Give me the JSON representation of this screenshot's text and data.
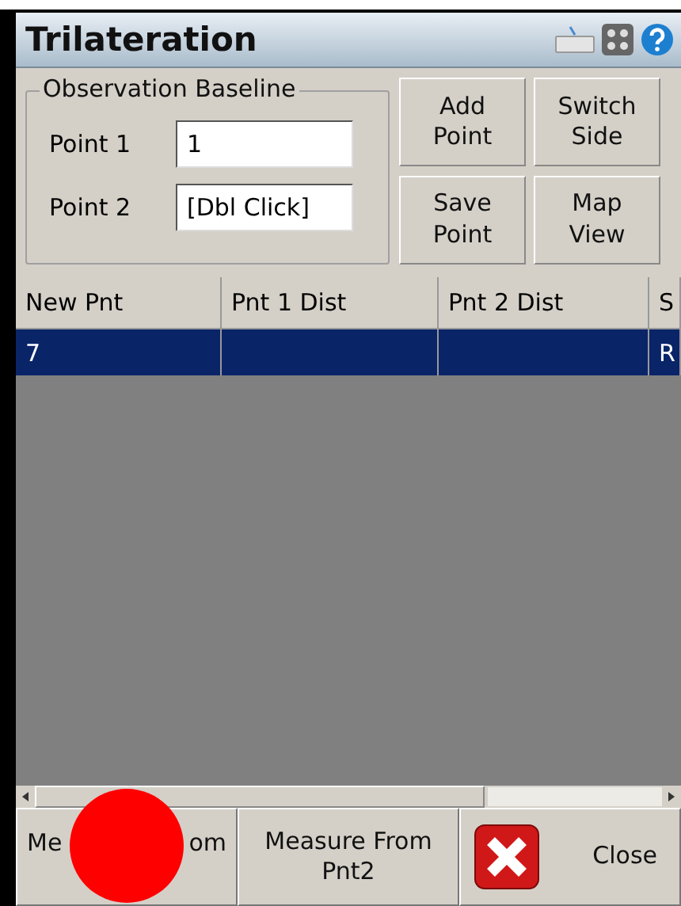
{
  "window": {
    "title": "Trilateration"
  },
  "baseline": {
    "title": "Observation Baseline",
    "fields": [
      {
        "label": "Point 1",
        "value": "1"
      },
      {
        "label": "Point 2",
        "value": "[Dbl Click]"
      }
    ]
  },
  "buttons": [
    {
      "label": "Add Point"
    },
    {
      "label": "Switch Side"
    },
    {
      "label": "Save Point"
    },
    {
      "label": "Map View"
    }
  ],
  "table": {
    "columns": [
      "New Pnt",
      "Pnt 1 Dist",
      "Pnt 2 Dist",
      "S"
    ],
    "rows": [
      {
        "cells": [
          "7",
          "",
          "",
          "R"
        ],
        "selected": true
      }
    ]
  },
  "bottom_buttons": [
    {
      "kind": "covered",
      "parts": [
        "Me",
        "om"
      ]
    },
    {
      "kind": "text",
      "label": "Measure From Pnt2"
    },
    {
      "kind": "close",
      "label": "Close"
    }
  ]
}
